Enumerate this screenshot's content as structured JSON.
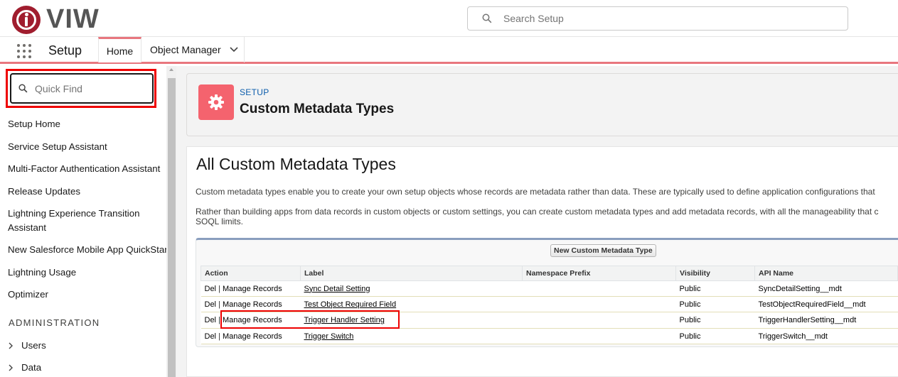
{
  "header": {
    "brand": "VIW",
    "search_placeholder": "Search Setup"
  },
  "nav": {
    "app_name": "Setup",
    "tabs": [
      {
        "label": "Home"
      },
      {
        "label": "Object Manager"
      }
    ]
  },
  "sidebar": {
    "quick_find_placeholder": "Quick Find",
    "items": [
      {
        "label": "Setup Home"
      },
      {
        "label": "Service Setup Assistant"
      },
      {
        "label": "Multi-Factor Authentication Assistant"
      },
      {
        "label": "Release Updates"
      },
      {
        "label": "Lightning Experience Transition Assistant"
      },
      {
        "label": "New Salesforce Mobile App QuickStart"
      },
      {
        "label": "Lightning Usage"
      },
      {
        "label": "Optimizer"
      }
    ],
    "section_header": "ADMINISTRATION",
    "tree": [
      {
        "label": "Users"
      },
      {
        "label": "Data"
      }
    ]
  },
  "page": {
    "breadcrumb": "SETUP",
    "title": "Custom Metadata Types",
    "content_title": "All Custom Metadata Types",
    "desc1": "Custom metadata types enable you to create your own setup objects whose records are metadata rather than data. These are typically used to define application configurations that",
    "desc2_line1": "Rather than building apps from data records in custom objects or custom settings, you can create custom metadata types and add metadata records, with all the manageability that c",
    "desc2_line2": "SOQL limits.",
    "new_button": "New Custom Metadata Type"
  },
  "table": {
    "columns": [
      "Action",
      "Label",
      "Namespace Prefix",
      "Visibility",
      "API Name"
    ],
    "action_del": "Del",
    "action_sep": "|",
    "action_manage": "Manage Records",
    "rows": [
      {
        "label": "Sync Detail Setting",
        "namespace": "",
        "visibility": "Public",
        "api_name": "SyncDetailSetting__mdt"
      },
      {
        "label": "Test Object Required Field",
        "namespace": "",
        "visibility": "Public",
        "api_name": "TestObjectRequiredField__mdt"
      },
      {
        "label": "Trigger Handler Setting",
        "namespace": "",
        "visibility": "Public",
        "api_name": "TriggerHandlerSetting__mdt"
      },
      {
        "label": "Trigger Switch",
        "namespace": "",
        "visibility": "Public",
        "api_name": "TriggerSwitch__mdt"
      }
    ]
  },
  "colors": {
    "brand": "#a01d2e",
    "accent": "#e8767e",
    "header_icon": "#f4636e",
    "link": "#015ba7",
    "highlight": "#ee0000"
  },
  "icons": [
    "viw-logo-icon",
    "search-icon",
    "app-launcher-icon",
    "chevron-down-icon",
    "gear-icon",
    "chevron-right-icon"
  ]
}
